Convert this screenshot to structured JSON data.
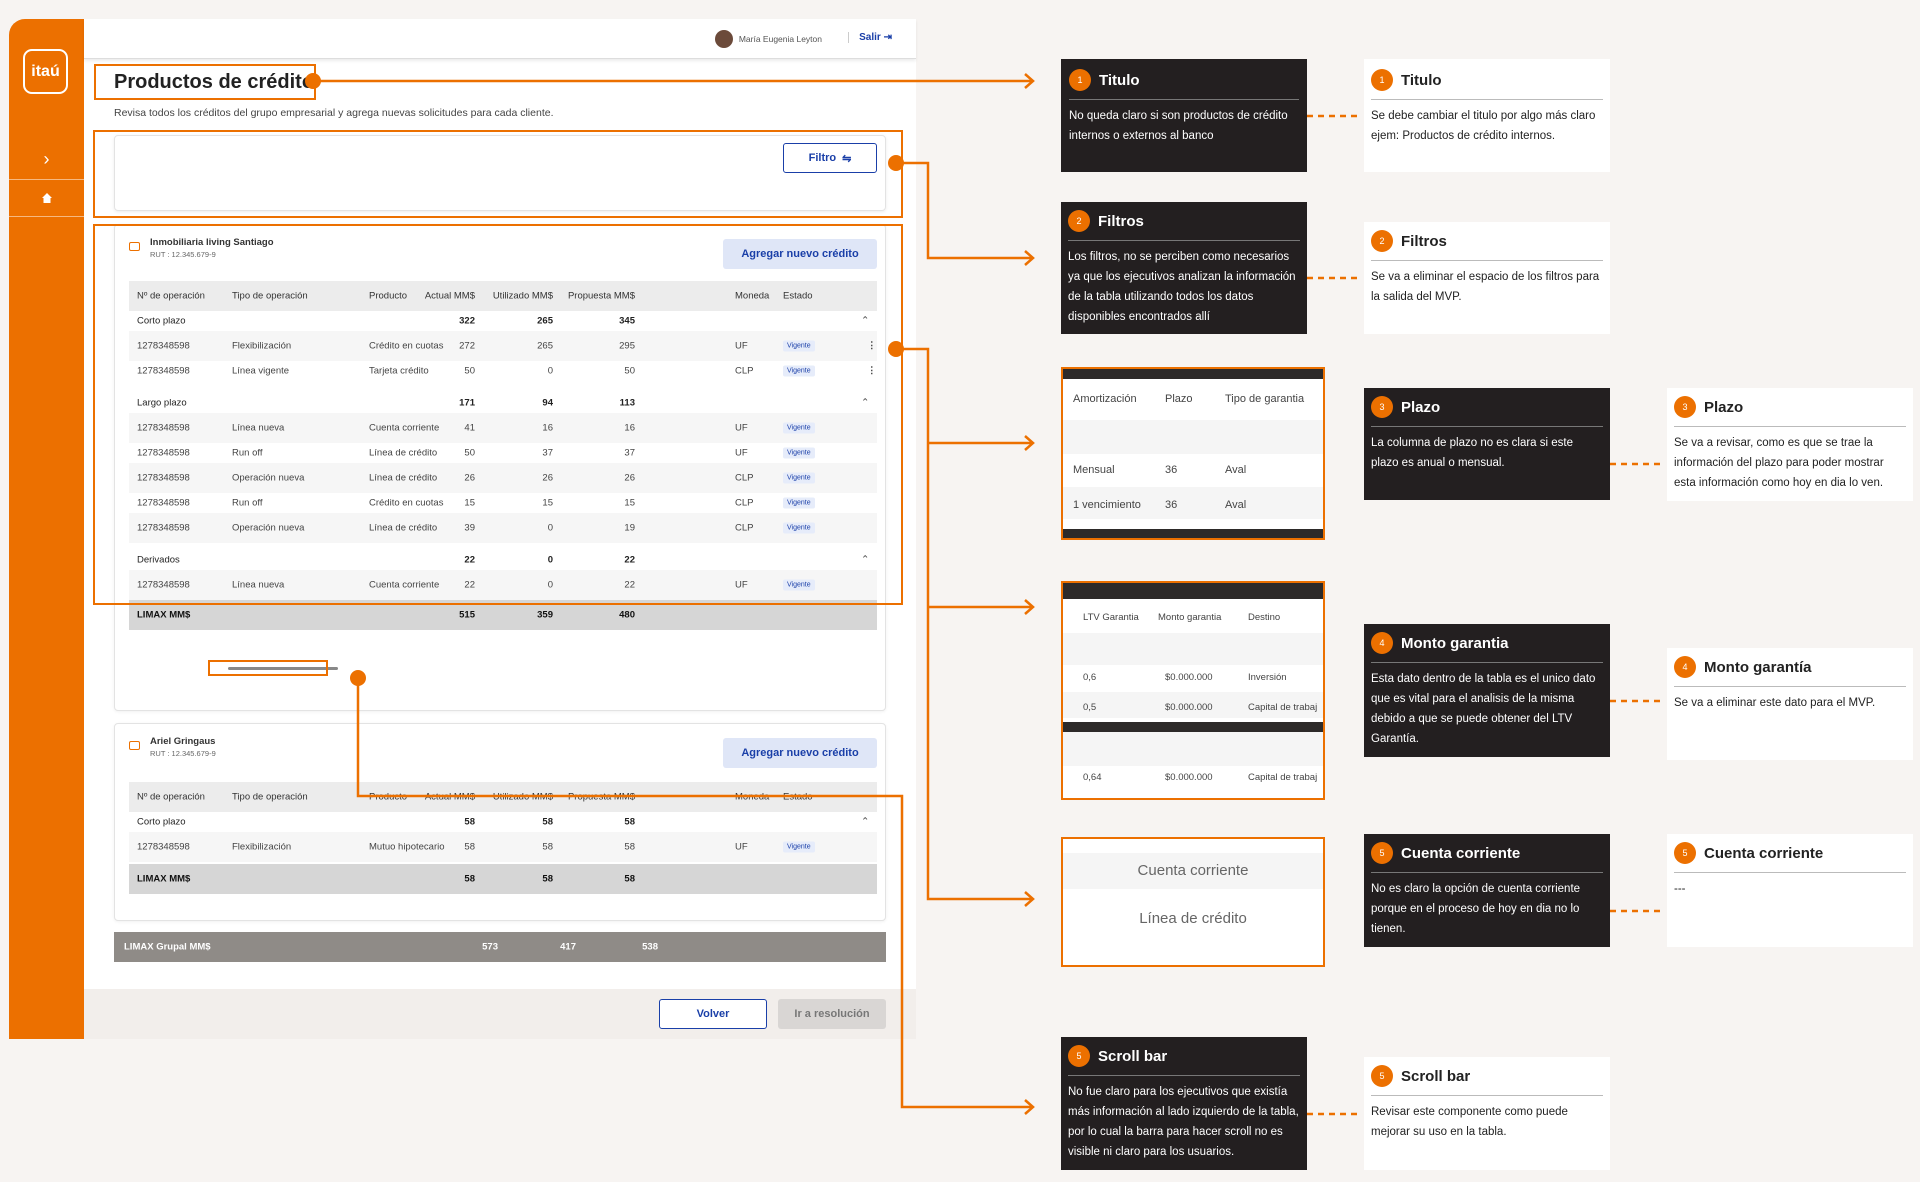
{
  "app": {
    "logo": "itaú",
    "user_name": "María Eugenia Leyton",
    "logout_label": "Salir",
    "title": "Productos de crédito",
    "subtitle": "Revisa todos los créditos del grupo empresarial y agrega nuevas solicitudes para cada cliente.",
    "filter_label": "Filtro",
    "columns": [
      "Nº de operación",
      "Tipo de operación",
      "Producto",
      "Actual MM$",
      "Utilizado MM$",
      "Propuesta MM$",
      "Moneda",
      "Estado"
    ],
    "companies": [
      {
        "name": "Inmobiliaria living Santiago",
        "rut": "RUT : 12.345.679-9",
        "add_label": "Agregar nuevo crédito",
        "groups": [
          {
            "name": "Corto plazo",
            "actual": "322",
            "utilizado": "265",
            "propuesta": "345",
            "rows": [
              {
                "op": "1278348598",
                "tipo": "Flexibilización",
                "producto": "Crédito en cuotas",
                "actual": "272",
                "utilizado": "265",
                "propuesta": "295",
                "moneda": "UF",
                "estado": "Vigente"
              },
              {
                "op": "1278348598",
                "tipo": "Línea vigente",
                "producto": "Tarjeta crédito",
                "actual": "50",
                "utilizado": "0",
                "propuesta": "50",
                "moneda": "CLP",
                "estado": "Vigente"
              }
            ]
          },
          {
            "name": "Largo plazo",
            "actual": "171",
            "utilizado": "94",
            "propuesta": "113",
            "rows": [
              {
                "op": "1278348598",
                "tipo": "Línea nueva",
                "producto": "Cuenta corriente",
                "actual": "41",
                "utilizado": "16",
                "propuesta": "16",
                "moneda": "UF",
                "estado": "Vigente"
              },
              {
                "op": "1278348598",
                "tipo": "Run off",
                "producto": "Línea de crédito",
                "actual": "50",
                "utilizado": "37",
                "propuesta": "37",
                "moneda": "UF",
                "estado": "Vigente"
              },
              {
                "op": "1278348598",
                "tipo": "Operación nueva",
                "producto": "Línea de crédito",
                "actual": "26",
                "utilizado": "26",
                "propuesta": "26",
                "moneda": "CLP",
                "estado": "Vigente"
              },
              {
                "op": "1278348598",
                "tipo": "Run off",
                "producto": "Crédito en cuotas",
                "actual": "15",
                "utilizado": "15",
                "propuesta": "15",
                "moneda": "CLP",
                "estado": "Vigente"
              },
              {
                "op": "1278348598",
                "tipo": "Operación nueva",
                "producto": "Línea de crédito",
                "actual": "39",
                "utilizado": "0",
                "propuesta": "19",
                "moneda": "CLP",
                "estado": "Vigente"
              }
            ]
          },
          {
            "name": "Derivados",
            "actual": "22",
            "utilizado": "0",
            "propuesta": "22",
            "rows": [
              {
                "op": "1278348598",
                "tipo": "Línea nueva",
                "producto": "Cuenta corriente",
                "actual": "22",
                "utilizado": "0",
                "propuesta": "22",
                "moneda": "UF",
                "estado": "Vigente"
              }
            ]
          }
        ],
        "total": {
          "label": "LIMAX MM$",
          "actual": "515",
          "utilizado": "359",
          "propuesta": "480"
        }
      },
      {
        "name": "Ariel Gringaus",
        "rut": "RUT : 12.345.679-9",
        "add_label": "Agregar nuevo crédito",
        "groups": [
          {
            "name": "Corto plazo",
            "actual": "58",
            "utilizado": "58",
            "propuesta": "58",
            "rows": [
              {
                "op": "1278348598",
                "tipo": "Flexibilización",
                "producto": "Mutuo hipotecario",
                "actual": "58",
                "utilizado": "58",
                "propuesta": "58",
                "moneda": "UF",
                "estado": "Vigente"
              }
            ]
          }
        ],
        "total": {
          "label": "LIMAX MM$",
          "actual": "58",
          "utilizado": "58",
          "propuesta": "58"
        }
      }
    ],
    "grupal": {
      "label": "LIMAX Grupal MM$",
      "actual": "573",
      "utilizado": "417",
      "propuesta": "538"
    },
    "back_label": "Volver",
    "resolve_label": "Ir a resolución"
  },
  "findings": [
    {
      "num": "1",
      "title": "Titulo",
      "text": "No queda claro si son productos de crédito internos o externos al banco"
    },
    {
      "num": "2",
      "title": "Filtros",
      "text": "Los filtros, no se perciben como necesarios ya que los ejecutivos analizan la información de la tabla utilizando todos los datos disponibles encontrados allí"
    },
    {
      "num": "3",
      "title": "Plazo",
      "text": "La columna de plazo no es clara si este plazo es anual o mensual."
    },
    {
      "num": "4",
      "title": "Monto garantia",
      "text": "Esta dato dentro de la tabla es el unico dato que es vital para el analisis de la misma debido a que se puede obtener del LTV Garantía."
    },
    {
      "num": "5",
      "title": "Cuenta corriente",
      "text": "No es claro la opción de cuenta corriente porque en el proceso de hoy en dia no lo tienen."
    },
    {
      "num": "5",
      "title": "Scroll bar",
      "text": "No fue claro para los ejecutivos que existía más información al lado izquierdo de la tabla, por lo cual la barra para hacer scroll no es visible ni claro para los usuarios."
    }
  ],
  "solutions": [
    {
      "num": "1",
      "title": "Titulo",
      "text": "Se debe cambiar el titulo por algo más claro ejem: Productos de crédito internos."
    },
    {
      "num": "2",
      "title": "Filtros",
      "text": "Se va a eliminar el espacio de los filtros para la salida del MVP."
    },
    {
      "num": "3",
      "title": "Plazo",
      "text": "Se va a revisar, como es que se trae la información del plazo para poder mostrar esta información como hoy en dia lo ven."
    },
    {
      "num": "4",
      "title": "Monto garantía",
      "text": "Se va a eliminar este dato para el MVP."
    },
    {
      "num": "5",
      "title": "Cuenta corriente",
      "text": "---"
    },
    {
      "num": "5",
      "title": "Scroll bar",
      "text": "Revisar este componente como puede mejorar su uso en la tabla."
    }
  ],
  "excerpts": {
    "plazo": {
      "headers": [
        "Amortización",
        "Plazo",
        "Tipo de garantia"
      ],
      "rows": [
        [
          "Mensual",
          "36",
          "Aval"
        ],
        [
          "1 vencimiento",
          "36",
          "Aval"
        ]
      ]
    },
    "garantia": {
      "headers": [
        "LTV Garantia",
        "Monto garantia",
        "Destino"
      ],
      "rows": [
        [
          "0,6",
          "$0.000.000",
          "Inversión"
        ],
        [
          "0,5",
          "$0.000.000",
          "Capital de trabaj"
        ],
        [
          "0,64",
          "$0.000.000",
          "Capital de trabaj"
        ]
      ]
    },
    "cuenta": {
      "items": [
        "Cuenta corriente",
        "Línea de crédito"
      ]
    }
  },
  "colors": {
    "accent": "#ec7000",
    "brand_blue": "#1a3fa8",
    "dark_card": "#231f20"
  }
}
